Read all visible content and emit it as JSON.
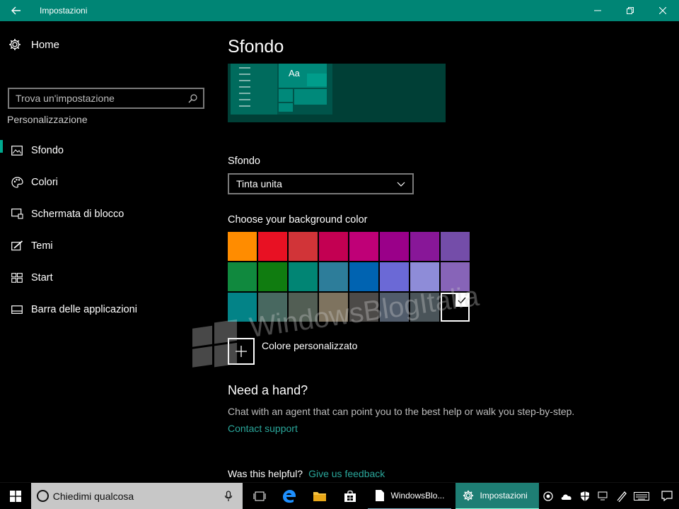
{
  "window": {
    "title": "Impostazioni",
    "accent": "#008575"
  },
  "sidebar": {
    "home_label": "Home",
    "search_placeholder": "Trova un'impostazione",
    "section_title": "Personalizzazione",
    "items": [
      {
        "label": "Sfondo",
        "icon": "picture-icon",
        "active": true
      },
      {
        "label": "Colori",
        "icon": "palette-icon",
        "active": false
      },
      {
        "label": "Schermata di blocco",
        "icon": "lock-screen-icon",
        "active": false
      },
      {
        "label": "Temi",
        "icon": "themes-brush-icon",
        "active": false
      },
      {
        "label": "Start",
        "icon": "start-tiles-icon",
        "active": false
      },
      {
        "label": "Barra delle applicazioni",
        "icon": "taskbar-icon",
        "active": false
      }
    ]
  },
  "main": {
    "title": "Sfondo",
    "preview_text": "Aa",
    "background_label": "Sfondo",
    "background_value": "Tinta unita",
    "colors_label": "Choose your background color",
    "colors": [
      "#ff8c00",
      "#e81123",
      "#d13438",
      "#c30052",
      "#bf0077",
      "#9a0089",
      "#881798",
      "#744da9",
      "#10893e",
      "#107c10",
      "#018574",
      "#2d7d9a",
      "#0063b1",
      "#6b69d6",
      "#8e8cd8",
      "#8764b8",
      "#038387",
      "#486860",
      "#525e54",
      "#7e735f",
      "#4c4a48",
      "#515c6b",
      "#4a5459",
      "#000000"
    ],
    "selected_color_index": 23,
    "custom_color_label": "Colore personalizzato",
    "help_title": "Need a hand?",
    "help_desc": "Chat with an agent that can point you to the best help or walk you step-by-step.",
    "contact_link": "Contact support",
    "helpful_question": "Was this helpful?",
    "feedback_link": "Give us feedback"
  },
  "watermark": {
    "text": "WindowsBlogItalia"
  },
  "taskbar": {
    "search_placeholder": "Chiedimi qualcosa",
    "apps": [
      {
        "label": "WindowsBlo...",
        "icon": "document-icon"
      },
      {
        "label": "Impostazioni",
        "icon": "gear-icon"
      }
    ]
  }
}
